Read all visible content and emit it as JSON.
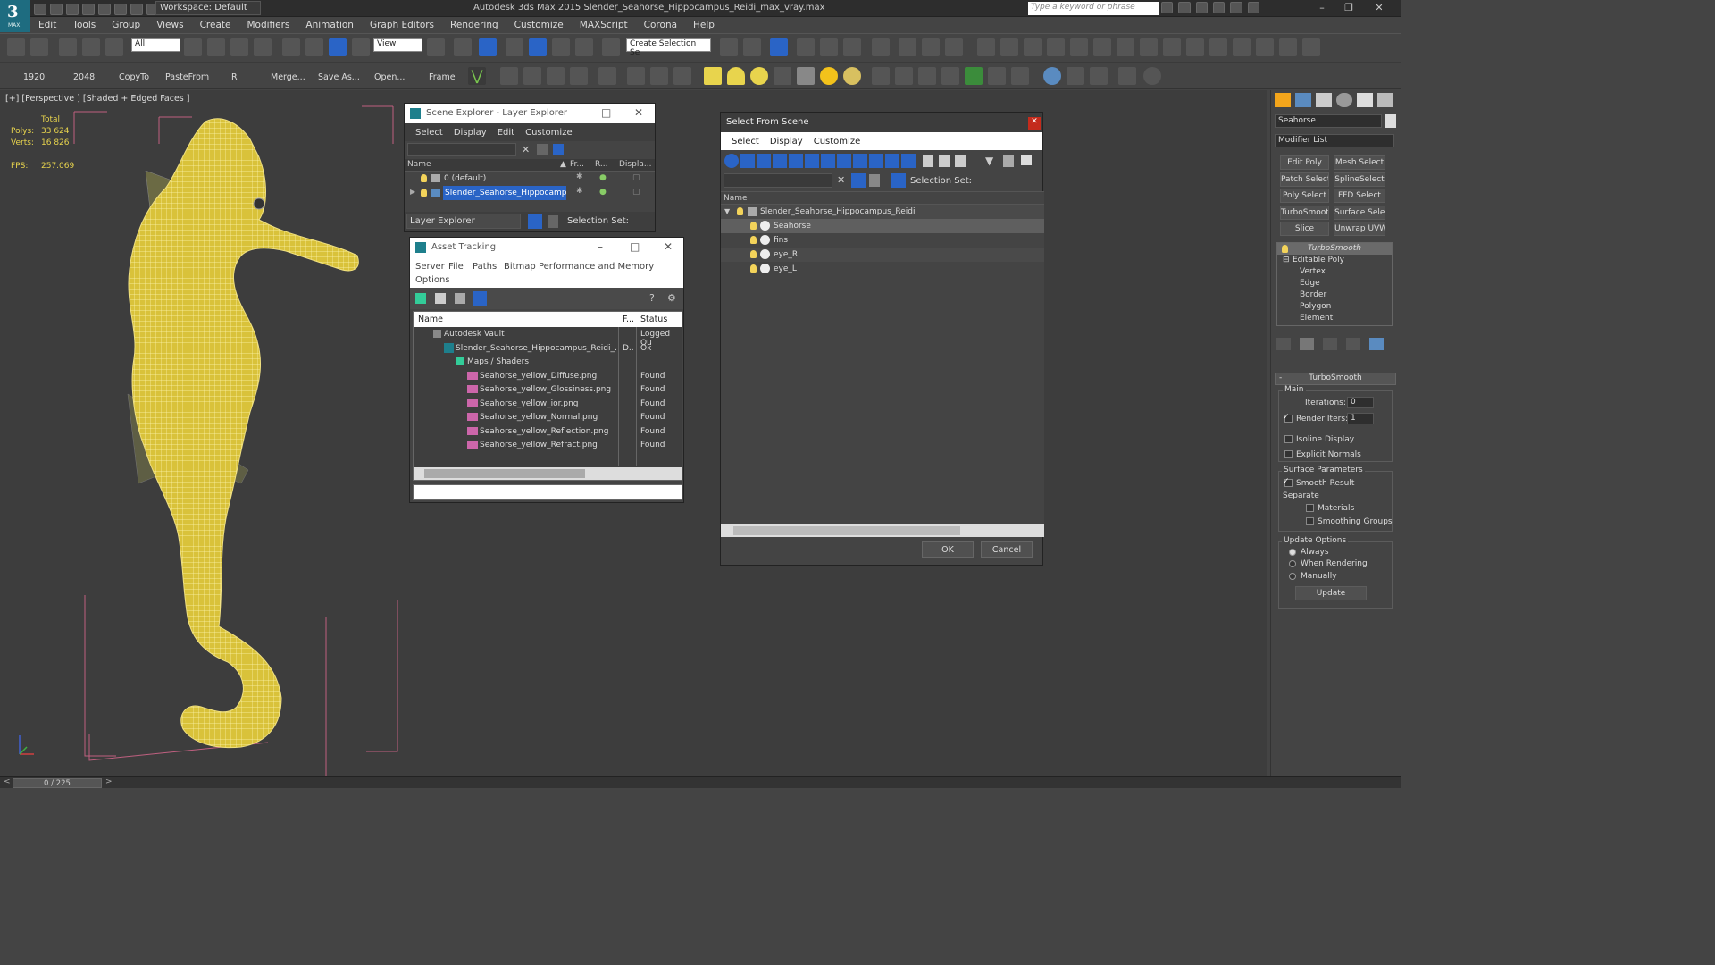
{
  "app": {
    "title": "Autodesk 3ds Max  2015     Slender_Seahorse_Hippocampus_Reidi_max_vray.max",
    "logo_label": "MAX",
    "workspace": "Workspace: Default",
    "search_placeholder": "Type a keyword or phrase"
  },
  "menubar": [
    "Edit",
    "Tools",
    "Group",
    "Views",
    "Create",
    "Modifiers",
    "Animation",
    "Graph Editors",
    "Rendering",
    "Customize",
    "MAXScript",
    "Corona",
    "Help"
  ],
  "toolbar1": {
    "filter_combo": "All",
    "view_combo": "View",
    "selection_set_combo": "Create Selection Se"
  },
  "toolbar2": {
    "buttons": [
      "1920",
      "2048",
      "CopyTo",
      "PasteFrom",
      "R",
      "Merge...",
      "Save As...",
      "Open...",
      "Frame"
    ]
  },
  "viewport": {
    "label": "[+] [Perspective ] [Shaded + Edged Faces ]",
    "stats": {
      "total_label": "Total",
      "polys_label": "Polys:",
      "polys_value": "33 624",
      "verts_label": "Verts:",
      "verts_value": "16 826",
      "fps_label": "FPS:",
      "fps_value": "257.069"
    }
  },
  "scene_explorer": {
    "title": "Scene Explorer - Layer Explorer",
    "menu": [
      "Select",
      "Display",
      "Edit",
      "Customize"
    ],
    "columns": [
      "Name",
      "Fr...",
      "R...",
      "Displa..."
    ],
    "rows": [
      "0 (default)",
      "Slender_Seahorse_Hippocampu..."
    ],
    "footer_combo": "Layer Explorer",
    "footer_label": "Selection Set:"
  },
  "asset_tracking": {
    "title": "Asset Tracking",
    "menu": [
      "Server",
      "File",
      "Paths",
      "Bitmap Performance and Memory"
    ],
    "menu2": "Options",
    "columns": [
      "Name",
      "F...",
      "Status"
    ],
    "rows": [
      {
        "name": "Autodesk Vault",
        "f": "",
        "status": "Logged Ou"
      },
      {
        "name": "Slender_Seahorse_Hippocampus_Reidi_...",
        "f": "D..",
        "status": "Ok"
      },
      {
        "name": "Maps / Shaders",
        "f": "",
        "status": ""
      },
      {
        "name": "Seahorse_yellow_Diffuse.png",
        "f": "",
        "status": "Found"
      },
      {
        "name": "Seahorse_yellow_Glossiness.png",
        "f": "",
        "status": "Found"
      },
      {
        "name": "Seahorse_yellow_ior.png",
        "f": "",
        "status": "Found"
      },
      {
        "name": "Seahorse_yellow_Normal.png",
        "f": "",
        "status": "Found"
      },
      {
        "name": "Seahorse_yellow_Reflection.png",
        "f": "",
        "status": "Found"
      },
      {
        "name": "Seahorse_yellow_Refract.png",
        "f": "",
        "status": "Found"
      }
    ]
  },
  "select_from_scene": {
    "title": "Select From Scene",
    "menu": [
      "Select",
      "Display",
      "Customize"
    ],
    "selection_set_label": "Selection Set:",
    "column": "Name",
    "root": "Slender_Seahorse_Hippocampus_Reidi",
    "children": [
      "Seahorse",
      "fins",
      "eye_R",
      "eye_L"
    ],
    "ok": "OK",
    "cancel": "Cancel"
  },
  "command_panel": {
    "object_name": "Seahorse",
    "modifier_list": "Modifier List",
    "buttons": [
      "Edit Poly",
      "Mesh Select",
      "Patch Select",
      "SplineSelect",
      "Poly Select",
      "FFD Select",
      "TurboSmooth",
      "Surface Select",
      "Slice",
      "Unwrap UVW"
    ],
    "stack": [
      "TurboSmooth",
      "Editable Poly",
      "Vertex",
      "Edge",
      "Border",
      "Polygon",
      "Element"
    ],
    "turbosmooth": {
      "header": "TurboSmooth",
      "main": "Main",
      "iterations_label": "Iterations:",
      "iterations_value": "0",
      "render_iters_label": "Render Iters:",
      "render_iters_value": "1",
      "isoline": "Isoline Display",
      "explicit": "Explicit Normals",
      "surface_params": "Surface Parameters",
      "smooth_result": "Smooth Result",
      "separate": "Separate",
      "materials": "Materials",
      "smoothing_groups": "Smoothing Groups",
      "update_options": "Update Options",
      "always": "Always",
      "when_rendering": "When Rendering",
      "manually": "Manually",
      "update": "Update"
    }
  },
  "status": {
    "frame": "0 / 225"
  },
  "colors": {
    "accent": "#1e7f8c",
    "selection": "#2a64c6",
    "mesh": "#e8d44d"
  }
}
